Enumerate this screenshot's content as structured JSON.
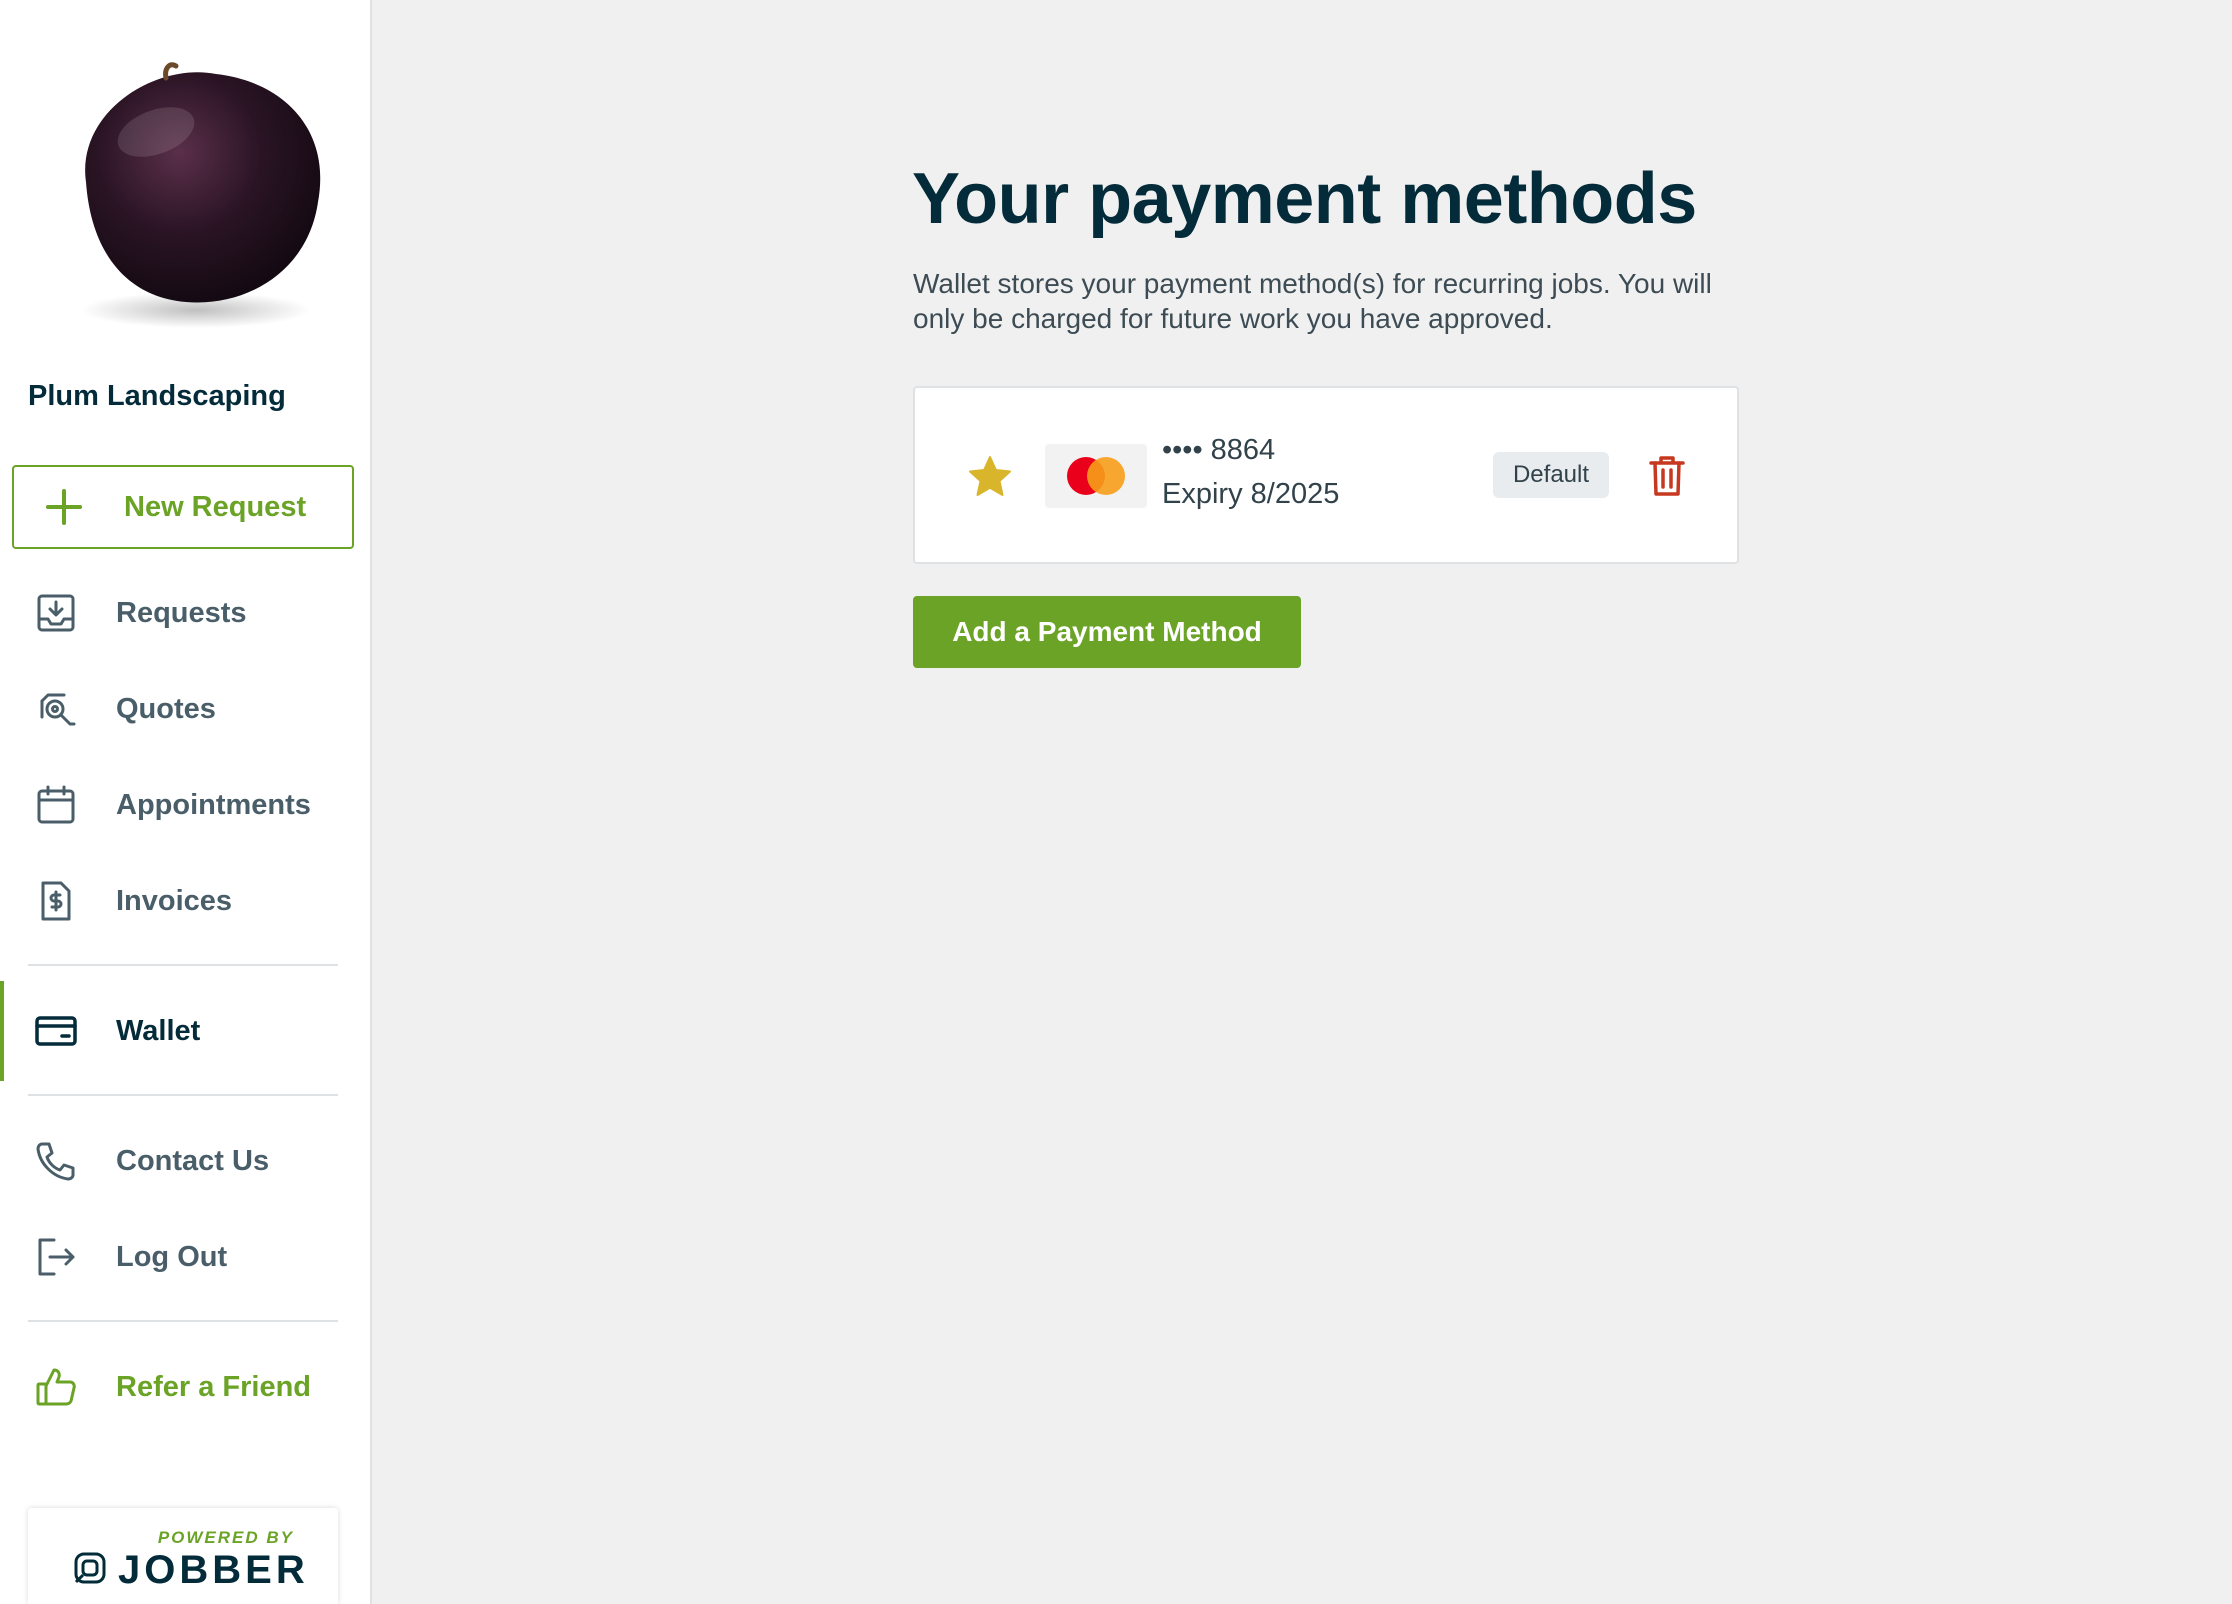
{
  "sidebar": {
    "company_name": "Plum Landscaping",
    "new_request_label": "New Request",
    "items": [
      {
        "label": "Requests",
        "icon": "inbox-download-icon"
      },
      {
        "label": "Quotes",
        "icon": "quote-search-icon"
      },
      {
        "label": "Appointments",
        "icon": "calendar-icon"
      },
      {
        "label": "Invoices",
        "icon": "invoice-dollar-icon"
      },
      {
        "label": "Wallet",
        "icon": "wallet-card-icon",
        "active": true
      },
      {
        "label": "Contact Us",
        "icon": "phone-icon"
      },
      {
        "label": "Log Out",
        "icon": "logout-icon"
      },
      {
        "label": "Refer a Friend",
        "icon": "thumbs-up-icon"
      }
    ],
    "powered_by": "POWERED BY",
    "brand": "JOBBER"
  },
  "main": {
    "title": "Your payment methods",
    "description": "Wallet stores your payment method(s) for recurring jobs. You will only be charged for future work you have approved.",
    "card": {
      "number": "•••• 8864",
      "expiry": "Expiry 8/2025",
      "badge": "Default",
      "brand_icon": "mastercard-icon"
    },
    "add_button": "Add a Payment Method"
  },
  "colors": {
    "accent": "#6aa326",
    "heading": "#032b3a",
    "star": "#d9b52c",
    "delete": "#c6381f"
  }
}
